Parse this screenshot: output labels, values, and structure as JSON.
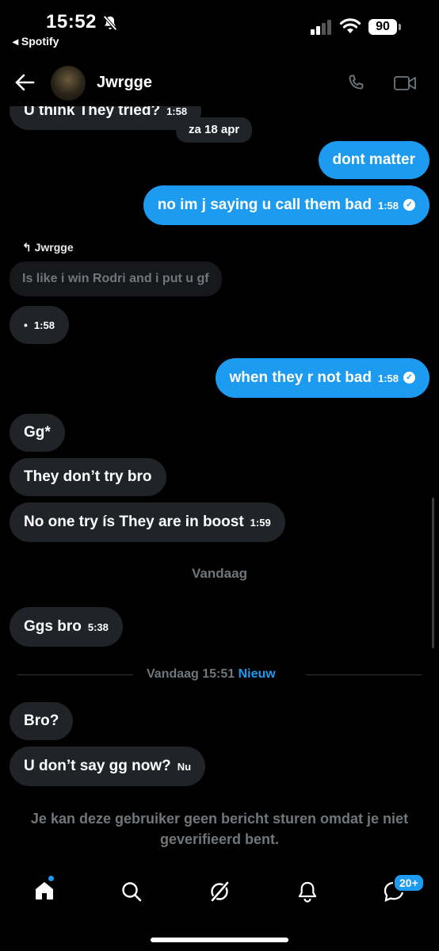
{
  "status_bar": {
    "time": "15:52",
    "back_app": "◂ Spotify",
    "battery": "90"
  },
  "header": {
    "name": "Jwrgge"
  },
  "messages": [
    {
      "text": "U think They tried?",
      "time": "1:58"
    },
    {
      "date": "za 18 apr"
    },
    {
      "text": "dont matter"
    },
    {
      "text": "no im j saying u call them bad",
      "time": "1:58"
    },
    {
      "reply_to": "Jwrgge",
      "quote": "Is like i win Rodri and i put u gf"
    },
    {
      "text": "•",
      "time": "1:58"
    },
    {
      "text": "when they r not bad",
      "time": "1:58"
    },
    {
      "text": "Gg*"
    },
    {
      "text": "They don’t try bro"
    },
    {
      "text": "No one try ís They are in boost",
      "time": "1:59"
    },
    {
      "separator": "Vandaag"
    },
    {
      "text": "Ggs bro",
      "time": "5:38"
    },
    {
      "new_separator": "Vandaag 15:51",
      "new_label": "Nieuw"
    },
    {
      "text": "Bro?"
    },
    {
      "text": "U don’t say gg now?",
      "time": "Nu"
    }
  ],
  "notice": "Je kan deze gebruiker geen bericht sturen omdat je niet geverifieerd bent.",
  "tabbar": {
    "messages_badge": "20+"
  },
  "colors": {
    "accent": "#1d9bf0",
    "incoming": "#202327",
    "muted": "#71767b"
  }
}
